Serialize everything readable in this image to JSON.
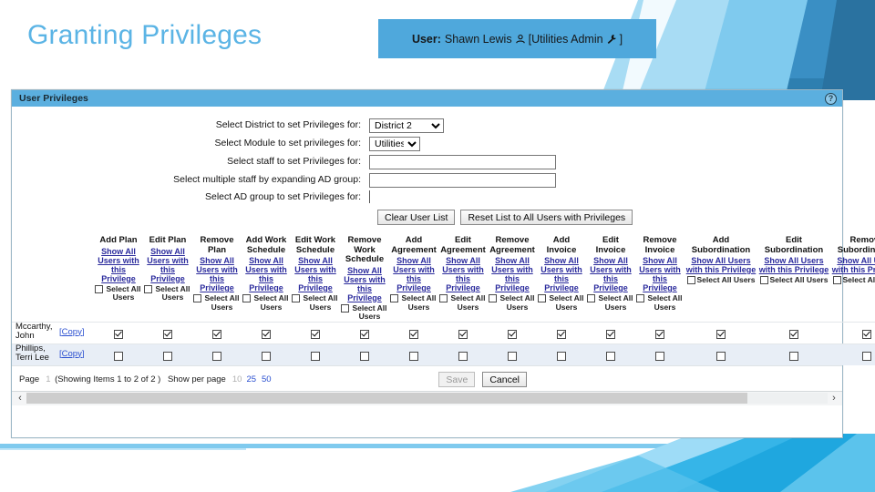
{
  "slide": {
    "title": "Granting Privileges",
    "title_color": "#5BB4E5",
    "banner_bg": "#4FA8DC"
  },
  "user_banner": {
    "label": "User:",
    "user_name": "Shawn Lewis",
    "person_icon": "person-icon",
    "open_bracket": "[",
    "role": "Utilities Admin",
    "wrench_icon": "wrench-icon",
    "close_bracket": "]"
  },
  "panel": {
    "title": "User Privileges",
    "help_icon": "help-icon",
    "help_glyph": "?"
  },
  "form": {
    "rows": [
      {
        "label": "Select District to set Privileges for:",
        "type": "select",
        "value": "District 2",
        "options": [
          "District 2"
        ]
      },
      {
        "label": "Select Module to set privileges for:",
        "type": "select",
        "value": "Utilities",
        "options": [
          "Utilities"
        ]
      },
      {
        "label": "Select staff to set Privileges for:",
        "type": "text",
        "value": "",
        "placeholder": ""
      },
      {
        "label": "Select multiple staff by expanding AD group:",
        "type": "text",
        "value": "",
        "placeholder": ""
      },
      {
        "label": "Select AD group to set Privileges for:",
        "type": "text-narrow",
        "value": "",
        "placeholder": ""
      }
    ],
    "buttons": [
      {
        "label": "Clear User List",
        "disabled": false
      },
      {
        "label": "Reset List to All Users with Privileges",
        "disabled": false
      }
    ]
  },
  "table": {
    "show_link_text": "Show All Users with this Privilege",
    "select_all_text": "Select All Users",
    "copy_label": "[Copy]",
    "columns": [
      {
        "title": "Add Plan",
        "select_all": false
      },
      {
        "title": "Edit Plan",
        "select_all": false
      },
      {
        "title": "Remove Plan",
        "select_all": false
      },
      {
        "title": "Add Work Schedule",
        "select_all": false
      },
      {
        "title": "Edit Work Schedule",
        "select_all": false
      },
      {
        "title": "Remove Work Schedule",
        "select_all": false
      },
      {
        "title": "Add Agreement",
        "select_all": false
      },
      {
        "title": "Edit Agreement",
        "select_all": false
      },
      {
        "title": "Remove Agreement",
        "select_all": false
      },
      {
        "title": "Add Invoice",
        "select_all": false
      },
      {
        "title": "Edit Invoice",
        "select_all": false
      },
      {
        "title": "Remove Invoice",
        "select_all": false
      },
      {
        "title": "Add Subordination",
        "select_all": false
      },
      {
        "title": "Edit Subordination",
        "select_all": false
      },
      {
        "title": "Remove Subordination",
        "select_all": false
      }
    ],
    "rows": [
      {
        "name": "Mccarthy, John",
        "copy": "[Copy]",
        "checks": [
          true,
          true,
          true,
          true,
          true,
          true,
          true,
          true,
          true,
          true,
          true,
          true,
          true,
          true,
          true
        ]
      },
      {
        "name": "Phillips, Terri Lee",
        "copy": "[Copy]",
        "checks": [
          false,
          false,
          false,
          false,
          false,
          false,
          false,
          false,
          false,
          false,
          false,
          false,
          false,
          false,
          false
        ]
      }
    ]
  },
  "footer": {
    "page_label": "Page",
    "page_number": "1",
    "showing_text": "(Showing Items 1 to 2 of 2 )",
    "show_per_page_label": "Show per page",
    "per_page_options": [
      "10",
      "25",
      "50"
    ],
    "per_page_selected": "10",
    "save_label": "Save",
    "save_disabled": true,
    "cancel_label": "Cancel",
    "cancel_disabled": false
  },
  "scrollbar": {
    "left_arrow": "‹",
    "right_arrow": "›",
    "thumb_percent": 90
  }
}
